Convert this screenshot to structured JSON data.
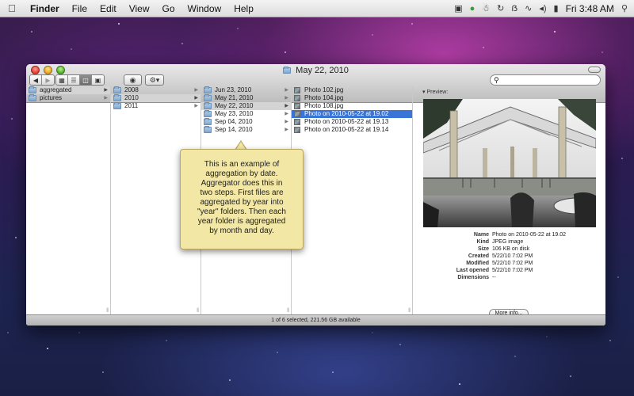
{
  "menubar": {
    "apple_icon": "apple-logo-icon",
    "items": [
      "Finder",
      "File",
      "Edit",
      "View",
      "Go",
      "Window",
      "Help"
    ],
    "clock": "Fri 3:48 AM"
  },
  "window": {
    "title": "May 22, 2010",
    "search_placeholder": ""
  },
  "columns": {
    "col1": [
      {
        "label": "aggregated",
        "selected": "grey",
        "has_children": true
      },
      {
        "label": "pictures",
        "selected": "none",
        "has_children": true
      }
    ],
    "col2": [
      {
        "label": "2008",
        "selected": "none",
        "has_children": true
      },
      {
        "label": "2010",
        "selected": "grey",
        "has_children": true
      },
      {
        "label": "2011",
        "selected": "none",
        "has_children": true
      }
    ],
    "col3": [
      {
        "label": "Jun 23, 2010",
        "selected": "none",
        "has_children": true
      },
      {
        "label": "May 21, 2010",
        "selected": "none",
        "has_children": true
      },
      {
        "label": "May 22, 2010",
        "selected": "grey",
        "has_children": true
      },
      {
        "label": "May 23, 2010",
        "selected": "none",
        "has_children": true
      },
      {
        "label": "Sep 04, 2010",
        "selected": "none",
        "has_children": true
      },
      {
        "label": "Sep 14, 2010",
        "selected": "none",
        "has_children": true
      }
    ],
    "col4": [
      {
        "label": "Photo 102.jpg",
        "selected": "none"
      },
      {
        "label": "Photo 104.jpg",
        "selected": "none"
      },
      {
        "label": "Photo 108.jpg",
        "selected": "none"
      },
      {
        "label": "Photo on 2010-05-22 at 19.02",
        "selected": "blue"
      },
      {
        "label": "Photo on 2010-05-22 at 19.13",
        "selected": "none"
      },
      {
        "label": "Photo on 2010-05-22 at 19.14",
        "selected": "none"
      }
    ]
  },
  "preview": {
    "label": "Preview:",
    "info": [
      {
        "key": "Name",
        "value": "Photo on 2010-05-22 at 19.02"
      },
      {
        "key": "Kind",
        "value": "JPEG image"
      },
      {
        "key": "Size",
        "value": "106 KB on disk"
      },
      {
        "key": "Created",
        "value": "5/22/10 7:02 PM"
      },
      {
        "key": "Modified",
        "value": "5/22/10 7:02 PM"
      },
      {
        "key": "Last opened",
        "value": "5/22/10 7:02 PM"
      },
      {
        "key": "Dimensions",
        "value": "--"
      }
    ],
    "more_info": "More info..."
  },
  "statusbar": "1 of 6 selected, 221.56 GB available",
  "callout": {
    "lines": [
      "This is an example of",
      "aggregation by date.",
      "Aggregator does this in",
      "two steps. First files are",
      "aggregated by year into",
      "\"year\" folders. Then each",
      "year folder is aggregated",
      "by month and day."
    ]
  }
}
